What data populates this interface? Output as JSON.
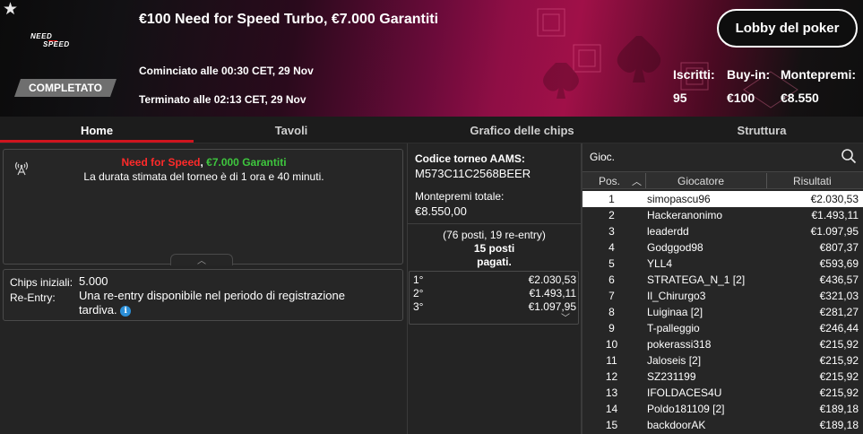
{
  "header": {
    "title": "€100 Need for Speed Turbo, €7.000 Garantiti",
    "logo_line1": "NEED",
    "logo_line2": "SPEED",
    "status_badge": "COMPLETATO",
    "started": "Cominciato alle 00:30 CET, 29 Nov",
    "ended": "Terminato alle 02:13 CET, 29 Nov",
    "lobby_button": "Lobby del poker",
    "stats": [
      {
        "label": "Iscritti:",
        "value": "95"
      },
      {
        "label": "Buy-in:",
        "value": "€100"
      },
      {
        "label": "Montepremi:",
        "value": "€8.550"
      }
    ]
  },
  "tabs": [
    {
      "label": "Home",
      "active": true
    },
    {
      "label": "Tavoli",
      "active": false
    },
    {
      "label": "Grafico delle chips",
      "active": false
    },
    {
      "label": "Struttura",
      "active": false
    }
  ],
  "info": {
    "name_red": "Need for Speed",
    "separator": ", ",
    "name_green": "€7.000 Garantiti",
    "duration": "La durata stimata del torneo è di 1 ora e 40 minuti."
  },
  "details": {
    "chips_label": "Chips iniziali:",
    "chips_value": "5.000",
    "reentry_label": "Re-Entry:",
    "reentry_value": "Una re-entry disponibile nel periodo di registrazione tardiva."
  },
  "middle": {
    "code_label": "Codice torneo AAMS:",
    "code_value": "M573C11C2568BEER",
    "prize_label": "Montepremi totale:",
    "prize_value": "€8.550,00",
    "places_line1": "(76 posti, 19 re-entry)",
    "places_line2": "15 posti",
    "places_line3": "pagati.",
    "prizes": [
      {
        "pos": "1°",
        "amount": "€2.030,53"
      },
      {
        "pos": "2°",
        "amount": "€1.493,11"
      },
      {
        "pos": "3°",
        "amount": "€1.097,95"
      }
    ]
  },
  "players": {
    "search_label": "Gioc.",
    "col_pos": "Pos.",
    "col_player": "Giocatore",
    "col_result": "Risultati",
    "rows": [
      {
        "pos": "1",
        "name": "simopascu96",
        "result": "€2.030,53"
      },
      {
        "pos": "2",
        "name": "Hackeranonimo",
        "result": "€1.493,11"
      },
      {
        "pos": "3",
        "name": "leaderdd",
        "result": "€1.097,95"
      },
      {
        "pos": "4",
        "name": "Godggod98",
        "result": "€807,37"
      },
      {
        "pos": "5",
        "name": "YLL4",
        "result": "€593,69"
      },
      {
        "pos": "6",
        "name": "STRATEGA_N_1 [2]",
        "result": "€436,57"
      },
      {
        "pos": "7",
        "name": "Il_Chirurgo3",
        "result": "€321,03"
      },
      {
        "pos": "8",
        "name": "Luiginaa [2]",
        "result": "€281,27"
      },
      {
        "pos": "9",
        "name": "T-palleggio",
        "result": "€246,44"
      },
      {
        "pos": "10",
        "name": "pokerassi318",
        "result": "€215,92"
      },
      {
        "pos": "11",
        "name": "Jaloseis [2]",
        "result": "€215,92"
      },
      {
        "pos": "12",
        "name": "SZ231199",
        "result": "€215,92"
      },
      {
        "pos": "13",
        "name": "IFOLDACES4U",
        "result": "€215,92"
      },
      {
        "pos": "14",
        "name": "Poldo181109 [2]",
        "result": "€189,18"
      },
      {
        "pos": "15",
        "name": "backdoorAK",
        "result": "€189,18"
      }
    ]
  }
}
